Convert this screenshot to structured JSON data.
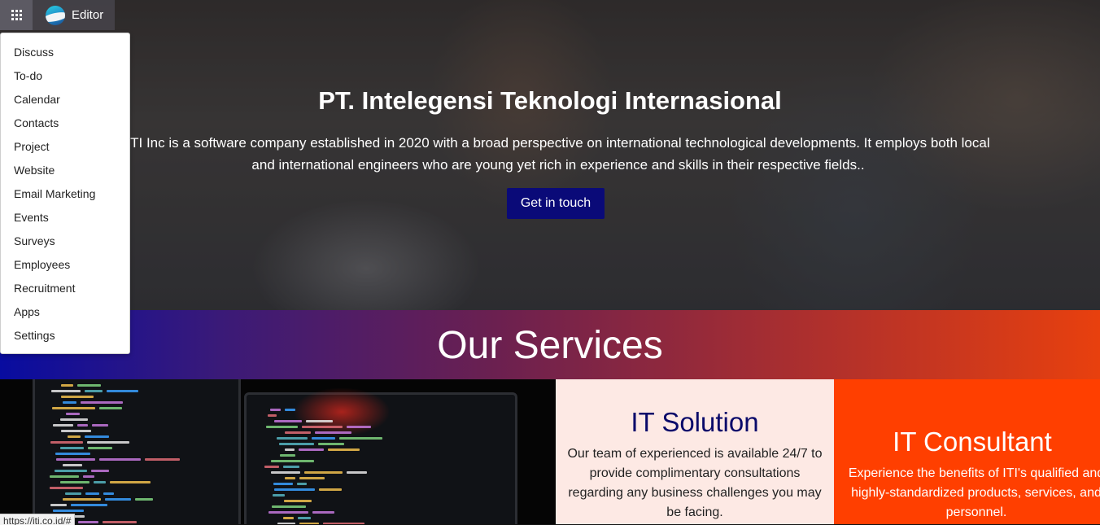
{
  "topbar": {
    "apps_icon": "grid-icon",
    "editor_label": "Editor",
    "logo_icon": "odoo-logo-icon"
  },
  "apps_menu": {
    "items": [
      "Discuss",
      "To-do",
      "Calendar",
      "Contacts",
      "Project",
      "Website",
      "Email Marketing",
      "Events",
      "Surveys",
      "Employees",
      "Recruitment",
      "Apps",
      "Settings"
    ]
  },
  "hero": {
    "title": "PT. Intelegensi Teknologi Internasional",
    "description": "ITI Inc is a software company established in 2020 with a broad perspective on international technological developments. It employs both local and international engineers who are young yet rich in experience and skills in their respective fields..",
    "button_label": "Get in touch",
    "button_color": "#0a0a78"
  },
  "services": {
    "title": "Our Services",
    "solution": {
      "title": "IT Solution",
      "text": "Our team of experienced is available 24/7 to provide complimentary consultations regarding any business challenges you may be facing."
    },
    "consultant": {
      "title": "IT Consultant",
      "text": "Experience the benefits of ITI's qualified and highly-standardized products, services, and personnel."
    }
  },
  "status_bar": {
    "url": "https://iti.co.id/#"
  },
  "colors": {
    "accent_orange": "#ff3f00",
    "solution_bg": "#fde9e4",
    "navy": "#0a0a6a"
  }
}
